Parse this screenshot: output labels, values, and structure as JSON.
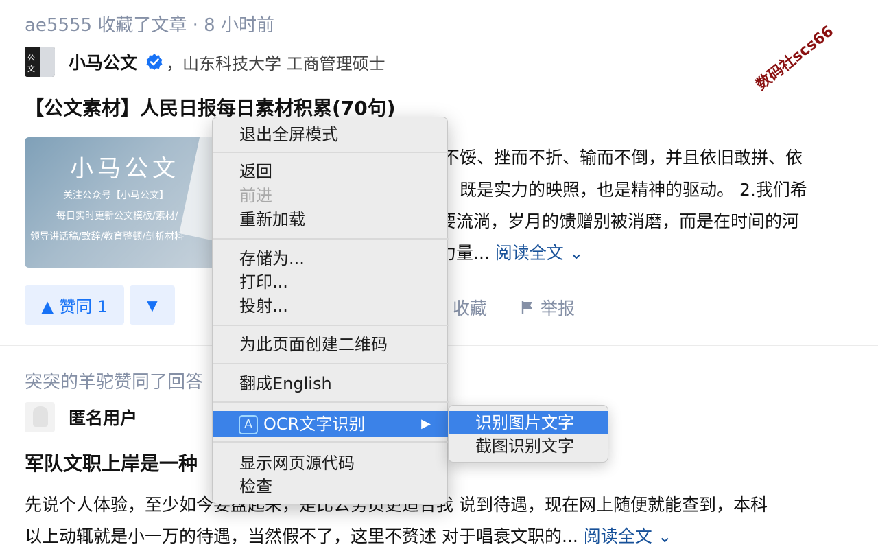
{
  "feed": {
    "item1": {
      "activity": "ae5555 收藏了文章 · 8 小时前",
      "author_name": "小马公文",
      "author_desc": "，山东科技大学 工商管理硕士",
      "title": "【公文素材】人民日报每日素材积累(70句)",
      "cover": {
        "title": "小马公文",
        "line1": "关注公众号【小马公文】",
        "line2": "每日实时更新公文模板/素材/",
        "line3": "领导讲话稿/致辞/教育整顿/剖析材料"
      },
      "excerpt_lines": [
        "而不馁、挫而不折、输而不倒，并且依旧敢拼、依",
        "既是实力的映照，也是精神的驱动。 2.我们希",
        "要流淌，岁月的馈赠别被消磨，而是在时间的河",
        "力量..."
      ],
      "read_more": "阅读全文 ⌄",
      "vote_up": "▲ 赞同 1",
      "vote_down": "▼",
      "collect": "收藏",
      "report": "举报"
    },
    "item2": {
      "activity": "突突的羊驼赞同了回答",
      "author_name": "匿名用户",
      "title": "军队文职上岸是一种",
      "excerpt_lines": [
        "先说个人体验，至少如今要盘起来，是比公务员更适合我 说到待遇，现在网上随便就能查到，本科",
        "以上动辄就是小一万的待遇，当然假不了，这里不赘述 对于唱衰文职的..."
      ],
      "read_more": "阅读全文 ⌄"
    }
  },
  "context_menu": {
    "items": [
      {
        "label": "退出全屏模式"
      },
      {
        "label": "返回"
      },
      {
        "label": "前进",
        "disabled": true
      },
      {
        "label": "重新加载"
      },
      {
        "label": "存储为..."
      },
      {
        "label": "打印..."
      },
      {
        "label": "投射..."
      },
      {
        "label": "为此页面创建二维码"
      },
      {
        "label": "翻成English"
      },
      {
        "label": "OCR文字识别"
      },
      {
        "label": "显示网页源代码"
      },
      {
        "label": "检查"
      }
    ],
    "ocr_icon": "A",
    "submenu": [
      {
        "label": "识别图片文字",
        "highlighted": true
      },
      {
        "label": "截图识别文字"
      }
    ]
  },
  "watermark": "数码社scs66",
  "colors": {
    "accent": "#1772f6",
    "menu_highlight": "#3b82e8",
    "muted": "#8590a6",
    "link": "#175199"
  }
}
